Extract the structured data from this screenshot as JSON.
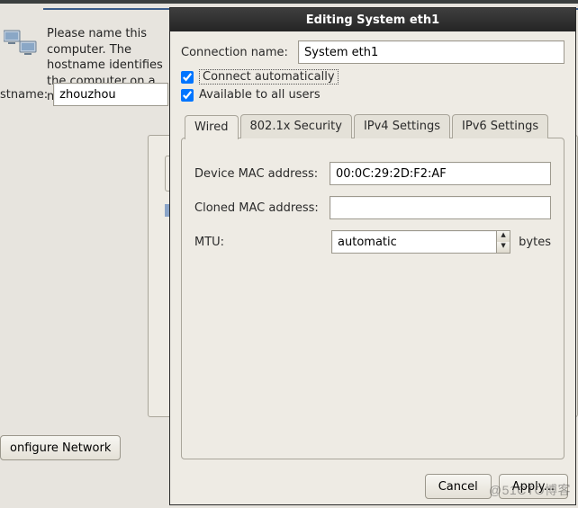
{
  "background": {
    "instruction": "Please name this computer. The hostname identifies the computer on a network.",
    "hostname_label": "stname:",
    "hostname_value": "zhouzhou",
    "configure_network_label": "onfigure Network"
  },
  "dialog": {
    "title": "Editing System eth1",
    "connection_name_label": "Connection name:",
    "connection_name_value": "System eth1",
    "connect_auto_checked": true,
    "connect_auto_label": "Connect automatically",
    "all_users_checked": true,
    "all_users_label": "Available to all users",
    "tabs": {
      "wired": "Wired",
      "security": "802.1x Security",
      "ipv4": "IPv4 Settings",
      "ipv6": "IPv6 Settings",
      "active": "wired"
    },
    "wired_panel": {
      "device_mac_label": "Device MAC address:",
      "device_mac_value": "00:0C:29:2D:F2:AF",
      "cloned_mac_label": "Cloned MAC address:",
      "cloned_mac_value": "",
      "mtu_label": "MTU:",
      "mtu_value": "automatic",
      "mtu_unit": "bytes"
    },
    "buttons": {
      "cancel": "Cancel",
      "apply": "Apply..."
    }
  },
  "watermark": "@51CTO博客"
}
